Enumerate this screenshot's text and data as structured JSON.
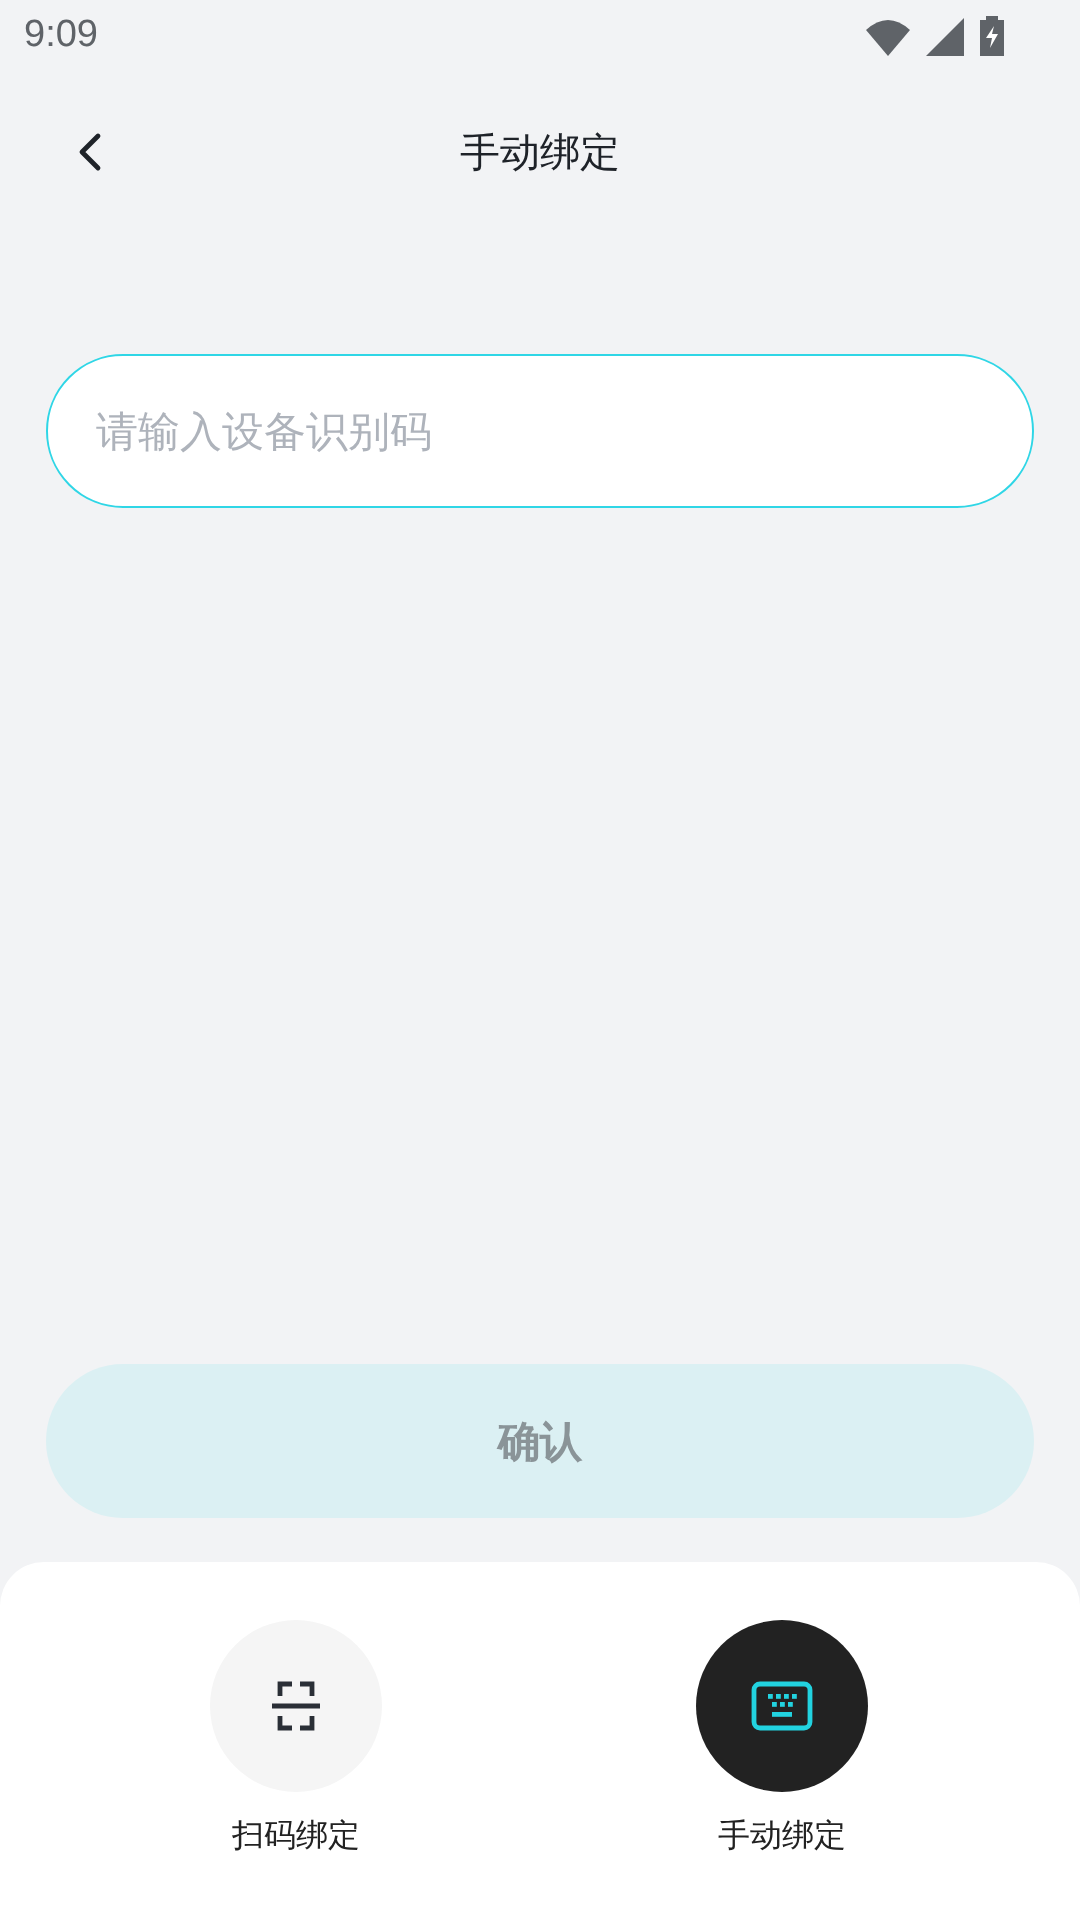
{
  "status_bar": {
    "time": "9:09"
  },
  "header": {
    "title": "手动绑定"
  },
  "input": {
    "placeholder": "请输入设备识别码"
  },
  "confirm": {
    "label": "确认",
    "disabled": true
  },
  "modes": [
    {
      "kind": "scan",
      "label": "扫码绑定",
      "selected": false
    },
    {
      "kind": "keyboard",
      "label": "手动绑定",
      "selected": true
    }
  ]
}
